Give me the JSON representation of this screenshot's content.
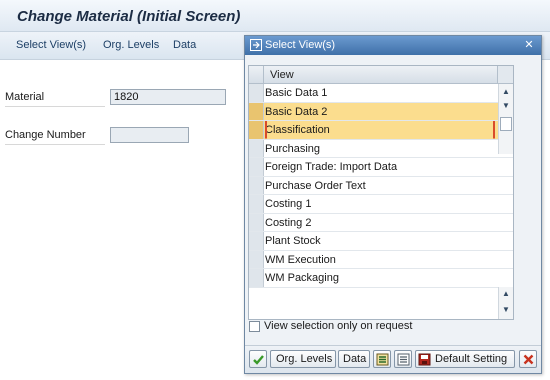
{
  "window": {
    "title": "Change Material (Initial Screen)"
  },
  "menu": {
    "items": [
      {
        "label": "Select View(s)"
      },
      {
        "label": "Org. Levels"
      },
      {
        "label": "Data"
      }
    ]
  },
  "form": {
    "material": {
      "label": "Material",
      "value": "1820"
    },
    "change_number": {
      "label": "Change Number",
      "value": ""
    }
  },
  "dialog": {
    "title": "Select View(s)",
    "column_header": "View",
    "views": [
      {
        "label": "Basic Data 1",
        "selected": false
      },
      {
        "label": "Basic Data 2",
        "selected": true
      },
      {
        "label": "Classification",
        "selected": true
      },
      {
        "label": "Purchasing",
        "selected": false
      },
      {
        "label": "Foreign Trade: Import Data",
        "selected": false
      },
      {
        "label": "Purchase Order Text",
        "selected": false
      },
      {
        "label": "Costing 1",
        "selected": false
      },
      {
        "label": "Costing 2",
        "selected": false
      },
      {
        "label": "Plant Stock",
        "selected": false
      },
      {
        "label": "WM Execution",
        "selected": false
      },
      {
        "label": "WM Packaging",
        "selected": false
      }
    ],
    "checkbox_label": "View selection only on request",
    "checkbox_checked": false,
    "buttons": {
      "org_levels": "Org. Levels",
      "data": "Data",
      "default_setting": "Default Setting"
    }
  },
  "colors": {
    "selected_row": "#fbdd8e",
    "dialog_title_bar": "#4f80b8",
    "confirm_icon": "#3a9a2a",
    "cancel_icon": "#c8321e"
  },
  "icons": [
    "window-icon",
    "close-icon",
    "checkmark-icon",
    "select-all-icon",
    "deselect-all-icon",
    "save-icon",
    "cancel-icon"
  ]
}
